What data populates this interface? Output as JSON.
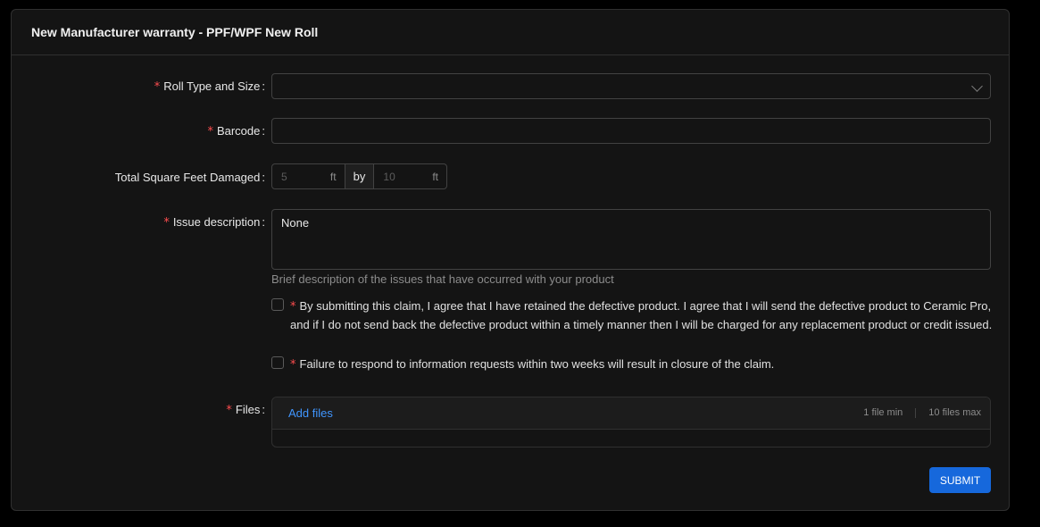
{
  "form": {
    "title": "New Manufacturer warranty - PPF/WPF New Roll",
    "required_mark": "*",
    "roll_type": {
      "label": "Roll Type and Size",
      "value": ""
    },
    "barcode": {
      "label": "Barcode",
      "value": ""
    },
    "damage": {
      "label": "Total Square Feet Damaged",
      "width_placeholder": "5",
      "length_placeholder": "10",
      "unit": "ft",
      "by_label": "by"
    },
    "issue": {
      "label": "Issue description",
      "value": "None",
      "help": "Brief description of the issues that have occurred with your product"
    },
    "agreement": {
      "line1": "By submitting this claim, I agree that I have retained the defective product. I agree that I will send the defective product to Ceramic Pro,",
      "line2": "and if I do not send back the defective product within a timely manner then I will be charged for any replacement product or credit issued.",
      "checked": false
    },
    "response_notice": {
      "text": "Failure to respond to information requests within two weeks will result in closure of the claim.",
      "checked": false
    },
    "files": {
      "label": "Files",
      "add_label": "Add files",
      "min_text": "1 file min",
      "max_text": "10 files max"
    },
    "submit_label": "SUBMIT"
  },
  "colors": {
    "background": "#000000",
    "card": "#141414",
    "border": "#424242",
    "required": "#ff4d4f",
    "link": "#4096ff",
    "primary": "#1668dc"
  }
}
